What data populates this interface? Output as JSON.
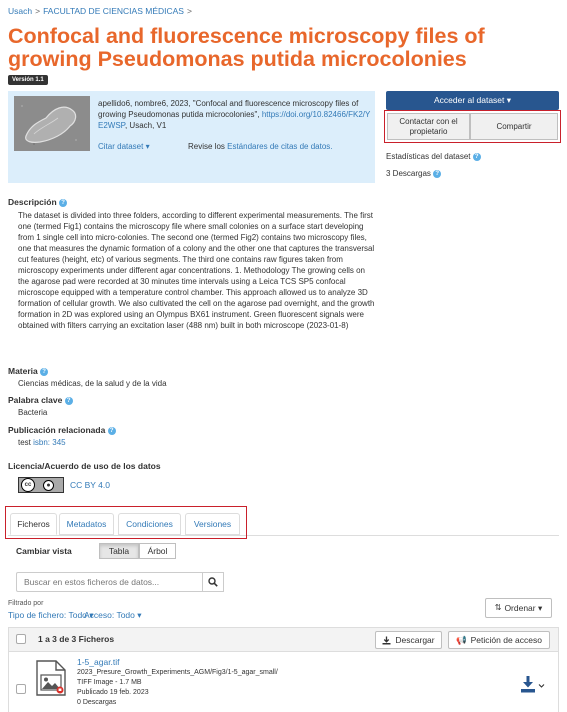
{
  "breadcrumb": {
    "root": "Usach",
    "sep": ">",
    "level": "FACULTAD DE CIENCIAS MÉDICAS",
    "sep2": ">"
  },
  "dataset": {
    "title": "Confocal and fluorescence microscopy files of growing Pseudomonas putida microcolonies",
    "version": "Versión 1.1"
  },
  "citation": {
    "text": "apellido6, nombre6, 2023, \"Confocal and fluorescence microscopy files of growing Pseudomonas putida microcolonies\", ",
    "doi": "https://doi.org/10.82466/FK2/YE2WSP",
    "tail": ", Usach, V1",
    "cite_dropdown": "Citar dataset ▾",
    "standards_prefix": "Revise los ",
    "standards_link": "Estándares de citas de datos."
  },
  "actions": {
    "access": "Acceder al dataset ▾",
    "contact": "Contactar con el propietario",
    "share": "Compartir",
    "stats_label": "Estadísticas del dataset",
    "downloads": "3 Descargas"
  },
  "metadata": {
    "desc_label": "Descripción",
    "description": "The dataset is divided into three folders, according to different experimental measurements. The first one (termed Fig1) contains the microscopy file where small colonies on a surface start developing from 1 single cell into micro-colonies. The second one (termed Fig2) contains two microscopy files, one that measures the dynamic formation of a colony and the other one that captures the transversal cut features (height, etc) of various segments. The third one contains raw figures taken from microscopy experiments under different agar concentrations. 1. Methodology The growing cells on the agarose pad were recorded at 30 minutes time intervals using a Leica TCS SP5 confocal microscope equipped with a temperature control chamber. This approach allowed us to analyze 3D formation of cellular growth. We also cultivated the cell on the agarose pad overnight, and the growth formation in 2D was explored using an Olympus BX61 instrument. Green fluorescent signals were obtained with filters carrying an excitation laser (488 nm) built in both microscope (2023-01-8)",
    "subject_label": "Materia",
    "subject": "Ciencias médicas, de la salud y de la vida",
    "keyword_label": "Palabra clave",
    "keyword": "Bacteria",
    "pub_label": "Publicación relacionada",
    "pub_prefix": "test ",
    "pub_link": "isbn: 345",
    "license_label": "Licencia/Acuerdo de uso de los datos",
    "license_link": "CC BY 4.0",
    "license_badge_cc": "cc",
    "license_badge_by": "BY"
  },
  "tabs": [
    "Ficheros",
    "Metadatos",
    "Condiciones",
    "Versiones"
  ],
  "files": {
    "view_label": "Cambiar vista",
    "view_table": "Tabla",
    "view_tree": "Árbol",
    "search_placeholder": "Buscar en estos ficheros de datos...",
    "filter_label": "Filtrado por",
    "filter_type": "Tipo de fichero: Todo ▾",
    "filter_access": "Acceso: Todo ▾",
    "sort": "Ordenar ▾",
    "count": "1 a 3 de 3 Ficheros",
    "download": "Descargar",
    "request": "Petición de acceso",
    "rows": [
      {
        "name": "1-5_agar.tif",
        "path": "2023_Presure_Growth_Experiments_AGM/Fig3/1-5_agar_small/",
        "type": "TIFF Image - 1.7 MB",
        "published": "Publicado 19 feb. 2023",
        "downloads": "0 Descargas"
      }
    ]
  },
  "colors": {
    "title": "#e8672b",
    "link": "#337ab7",
    "primary": "#28568f",
    "highlight": "#c9202b",
    "citation_bg": "#dceefb"
  }
}
